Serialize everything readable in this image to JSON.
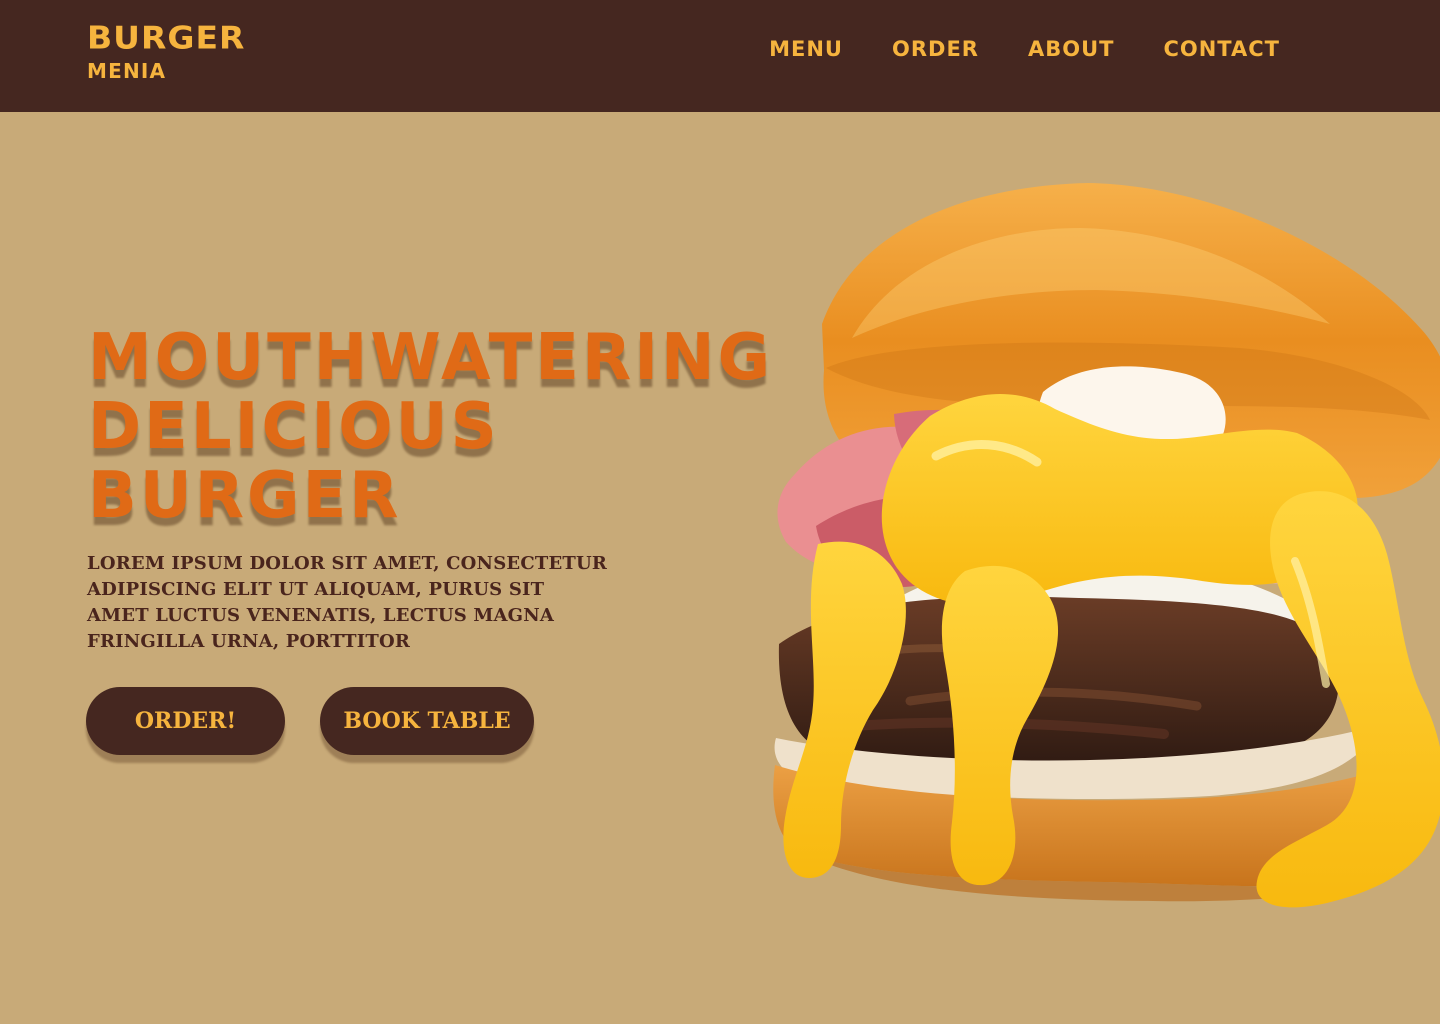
{
  "brand": {
    "name": "BURGER",
    "sub": "MENIA"
  },
  "nav": {
    "items": [
      "MENU",
      "ORDER",
      "ABOUT",
      "CONTACT"
    ]
  },
  "hero": {
    "title_lines": [
      "MOUTHWATERING",
      "DELICIOUS",
      "BURGER"
    ],
    "description": "LOREM IPSUM DOLOR SIT AMET, CONSECTETUR ADIPISCING ELIT UT ALIQUAM, PURUS SIT AMET LUCTUS VENENATIS, LECTUS MAGNA FRINGILLA URNA, PORTTITOR",
    "buttons": {
      "order": "ORDER!",
      "book": "BOOK TABLE"
    }
  },
  "image": {
    "subject": "burger-illustration"
  },
  "colors": {
    "header_bg": "#452720",
    "page_bg": "#c8aa78",
    "brand_yellow": "#f6b43e",
    "title_orange": "#e06a16",
    "text_dark": "#4a251d"
  }
}
